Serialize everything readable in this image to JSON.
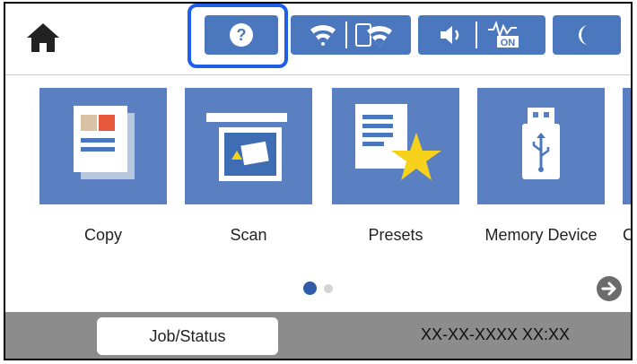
{
  "topbar": {
    "home_icon": "home-icon",
    "help_icon": "help-question-icon",
    "help_symbol": "?",
    "network_icons": [
      "wifi-icon",
      "wifi-direct-icon"
    ],
    "sound_icon": "speaker-icon",
    "quiet_mode_icon": "quiet-mode-icon",
    "quiet_mode_badge": "ON",
    "sleep_icon": "moon-icon",
    "highlight_color": "#1f5ee8",
    "button_color": "#4a77bd"
  },
  "tiles": [
    {
      "label": "Copy",
      "icon": "copy-icon"
    },
    {
      "label": "Scan",
      "icon": "scan-icon"
    },
    {
      "label": "Presets",
      "icon": "presets-star-icon"
    },
    {
      "label": "Memory Device",
      "icon": "usb-memory-icon"
    },
    {
      "label": "C"
    }
  ],
  "pager": {
    "pages": 2,
    "current": 1,
    "next_icon": "next-arrow-icon"
  },
  "bottombar": {
    "job_status_label": "Job/Status",
    "datetime": "XX-XX-XXXX XX:XX"
  }
}
